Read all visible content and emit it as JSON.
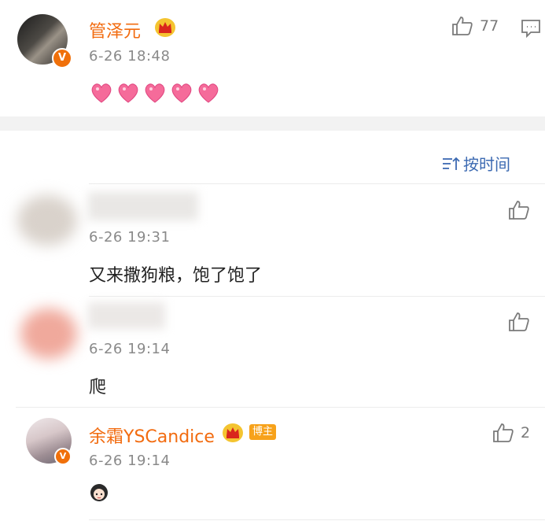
{
  "top_comment": {
    "username": "管泽元",
    "timestamp": "6-26 18:48",
    "like_count": "77",
    "emoji": [
      "heart-emoji",
      "heart-emoji",
      "heart-emoji",
      "heart-emoji",
      "heart-emoji"
    ]
  },
  "sort": {
    "label": "按时间"
  },
  "replies": [
    {
      "timestamp": "6-26 19:31",
      "content": "又来撒狗粮，饱了饱了"
    },
    {
      "timestamp": "6-26 19:14",
      "content": "爬"
    },
    {
      "username": "余霜YSCandice",
      "badge": "博主",
      "timestamp": "6-26 19:14",
      "like_count": "2"
    }
  ],
  "colors": {
    "name": "#f26b0f",
    "time": "#8a8a8a",
    "link": "#3c6ab2",
    "verified": "#f0700a"
  }
}
